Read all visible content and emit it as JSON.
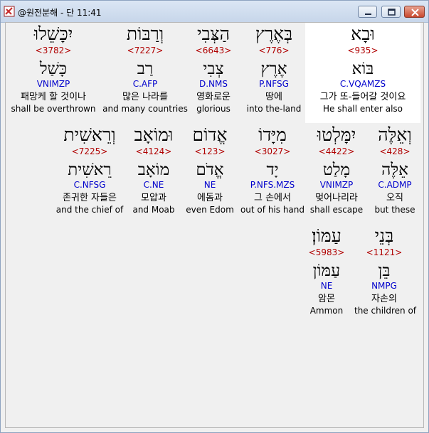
{
  "window": {
    "title": "@원전분해 - 단 11:41",
    "icon": "app-logo-icon",
    "buttons": [
      "minimize-icon",
      "maximize-icon",
      "close-icon"
    ]
  },
  "words": [
    {
      "heb": "וּבָא",
      "strong": "<935>",
      "lemma": "בּוֹא",
      "morph": "C.VQAMZS",
      "kor": "그가 또-들어갈 것이요",
      "eng": "He shall enter also",
      "highlighted": true
    },
    {
      "heb": "בְּאֶרֶץ",
      "strong": "<776>",
      "lemma": "אֶרֶץ",
      "morph": "P.NFSG",
      "kor": "땅에",
      "eng": "into the-land"
    },
    {
      "heb": "הַצְּבִי",
      "strong": "<6643>",
      "lemma": "צְבִי",
      "morph": "D.NMS",
      "kor": "영화로운",
      "eng": "glorious"
    },
    {
      "heb": "וְרַבּוֹת",
      "strong": "<7227>",
      "lemma": "רַב",
      "morph": "C.AFP",
      "kor": "많은 나라를",
      "eng": "and many countries"
    },
    {
      "heb": "יִכָּשֵׁלוּ",
      "strong": "<3782>",
      "lemma": "כָּשַׁל",
      "morph": "VNIMZP",
      "kor": "패망케 할 것이나",
      "eng": "shall be overthrown"
    },
    {
      "heb": "וְאֵלֶּה",
      "strong": "<428>",
      "lemma": "אֵלֶּה",
      "morph": "C.ADMP",
      "kor": "오직",
      "eng": "but these"
    },
    {
      "heb": "יִמָּלְטוּ",
      "strong": "<4422>",
      "lemma": "מָלַט",
      "morph": "VNIMZP",
      "kor": "멎어나리라",
      "eng": "shall escape"
    },
    {
      "heb": "מִיָּדוֹ",
      "strong": "<3027>",
      "lemma": "יָד",
      "morph": "P.NFS.MZS",
      "kor": "그 손에서",
      "eng": "out of his hand"
    },
    {
      "heb": "אֱדוֹם",
      "strong": "<123>",
      "lemma": "אֱדֹם",
      "morph": "NE",
      "kor": "에돔과",
      "eng": "even Edom"
    },
    {
      "heb": "וּמוֹאָב",
      "strong": "<4124>",
      "lemma": "מוֹאָב",
      "morph": "C.NE",
      "kor": "모압과",
      "eng": "and Moab"
    },
    {
      "heb": "וְרֵאשִׁית",
      "strong": "<7225>",
      "lemma": "רֵאשִׁית",
      "morph": "C.NFSG",
      "kor": "존귀한 자들은",
      "eng": "and the chief of"
    },
    {
      "heb": "בְּנֵי",
      "strong": "<1121>",
      "lemma": "בֵּן",
      "morph": "NMPG",
      "kor": "자손의",
      "eng": "the children of"
    },
    {
      "heb": "עַמּוֹן׃",
      "strong": "<5983>",
      "lemma": "עַמּוֹן",
      "morph": "NE",
      "kor": "암몬",
      "eng": "Ammon"
    }
  ]
}
